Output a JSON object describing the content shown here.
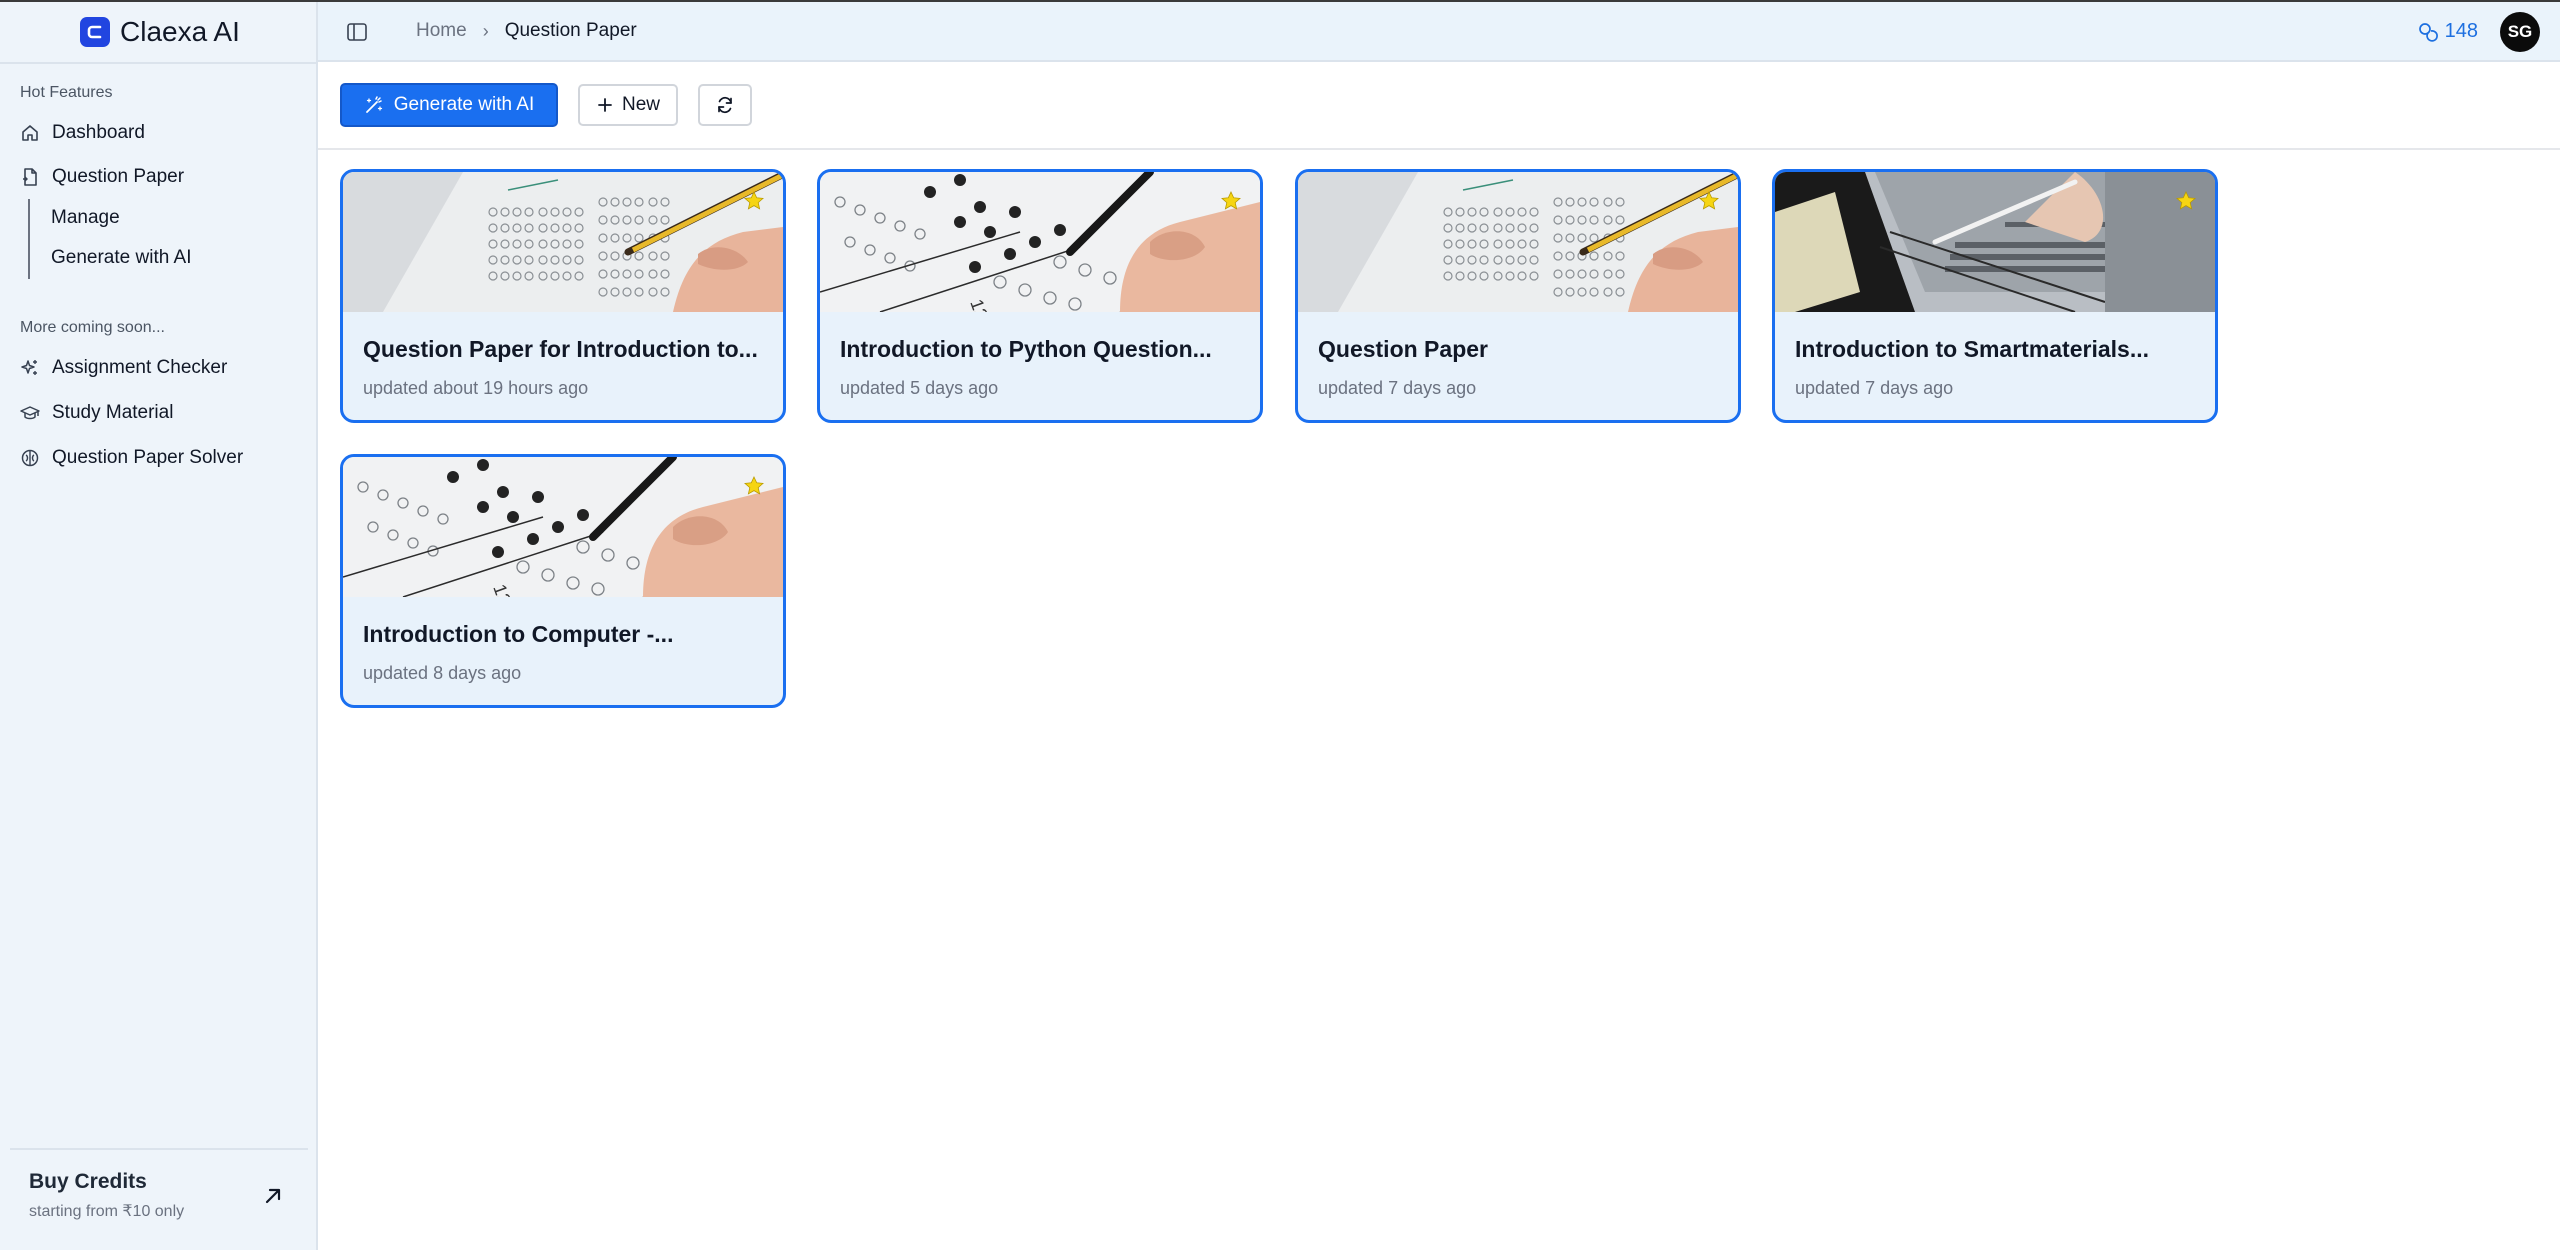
{
  "app": {
    "brand": "Claexa AI"
  },
  "sidebar": {
    "hot_label": "Hot Features",
    "dashboard": "Dashboard",
    "question_paper": "Question Paper",
    "sub_manage": "Manage",
    "sub_generate": "Generate with AI",
    "more_label": "More coming soon...",
    "assignment_checker": "Assignment Checker",
    "study_material": "Study Material",
    "question_paper_solver": "Question Paper Solver",
    "buy_title": "Buy Credits",
    "buy_sub": "starting from ₹10 only"
  },
  "topbar": {
    "breadcrumb": [
      "Home",
      "Question Paper"
    ],
    "credits": "148",
    "avatar_initials": "SG"
  },
  "toolbar": {
    "generate_label": "Generate with AI",
    "new_label": "New"
  },
  "cards": [
    {
      "title": "Question Paper for Introduction to...",
      "updated": "updated about 19 hours ago",
      "image": "omr-pencil",
      "starred": true
    },
    {
      "title": "Introduction to Python Question...",
      "updated": "updated 5 days ago",
      "image": "omr-pen",
      "starred": true
    },
    {
      "title": "Question Paper",
      "updated": "updated 7 days ago",
      "image": "omr-pencil",
      "starred": true
    },
    {
      "title": "Introduction to Smartmaterials...",
      "updated": "updated 7 days ago",
      "image": "omr-sheet-dark",
      "starred": true
    },
    {
      "title": "Introduction to Computer -...",
      "updated": "updated 8 days ago",
      "image": "omr-pen",
      "starred": true
    }
  ],
  "colors": {
    "accent": "#1a6ff0",
    "brand": "#2145e0",
    "star": "#f6d513"
  }
}
